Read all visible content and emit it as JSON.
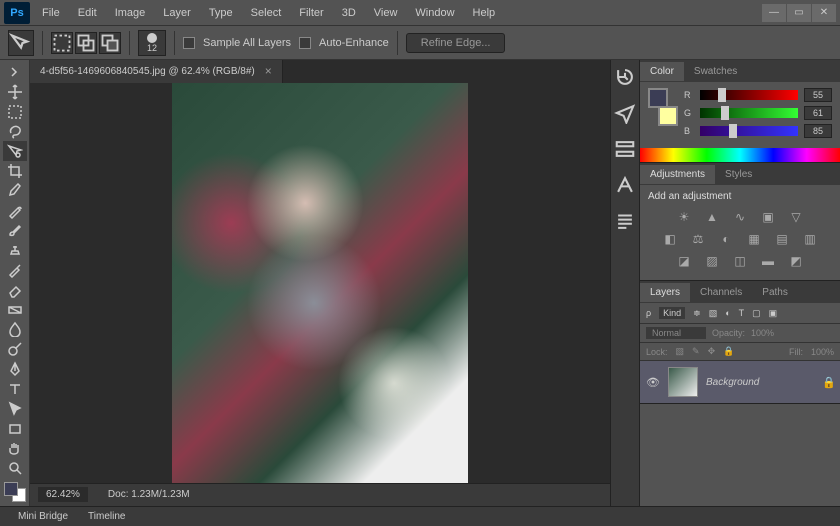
{
  "app": {
    "logo": "Ps"
  },
  "menu": [
    "File",
    "Edit",
    "Image",
    "Layer",
    "Type",
    "Select",
    "Filter",
    "3D",
    "View",
    "Window",
    "Help"
  ],
  "options_bar": {
    "brush_size": "12",
    "sample_all_layers": "Sample All Layers",
    "auto_enhance": "Auto-Enhance",
    "refine_edge": "Refine Edge..."
  },
  "document": {
    "tab_label": "4-d5f56-1469606840545.jpg @ 62.4% (RGB/8#)",
    "zoom": "62.42%",
    "doc_info": "Doc: 1.23M/1.23M"
  },
  "color_panel": {
    "tabs": [
      "Color",
      "Swatches"
    ],
    "channels": {
      "r": "55",
      "g": "61",
      "b": "85"
    }
  },
  "adjustments_panel": {
    "tabs": [
      "Adjustments",
      "Styles"
    ],
    "title": "Add an adjustment"
  },
  "layers_panel": {
    "tabs": [
      "Layers",
      "Channels",
      "Paths"
    ],
    "filter_label": "Kind",
    "blend_mode": "Normal",
    "opacity_label": "Opacity:",
    "opacity_value": "100%",
    "lock_label": "Lock:",
    "fill_label": "Fill:",
    "fill_value": "100%",
    "layers": [
      {
        "name": "Background",
        "locked": true
      }
    ]
  },
  "bottom_tabs": [
    "Mini Bridge",
    "Timeline"
  ]
}
